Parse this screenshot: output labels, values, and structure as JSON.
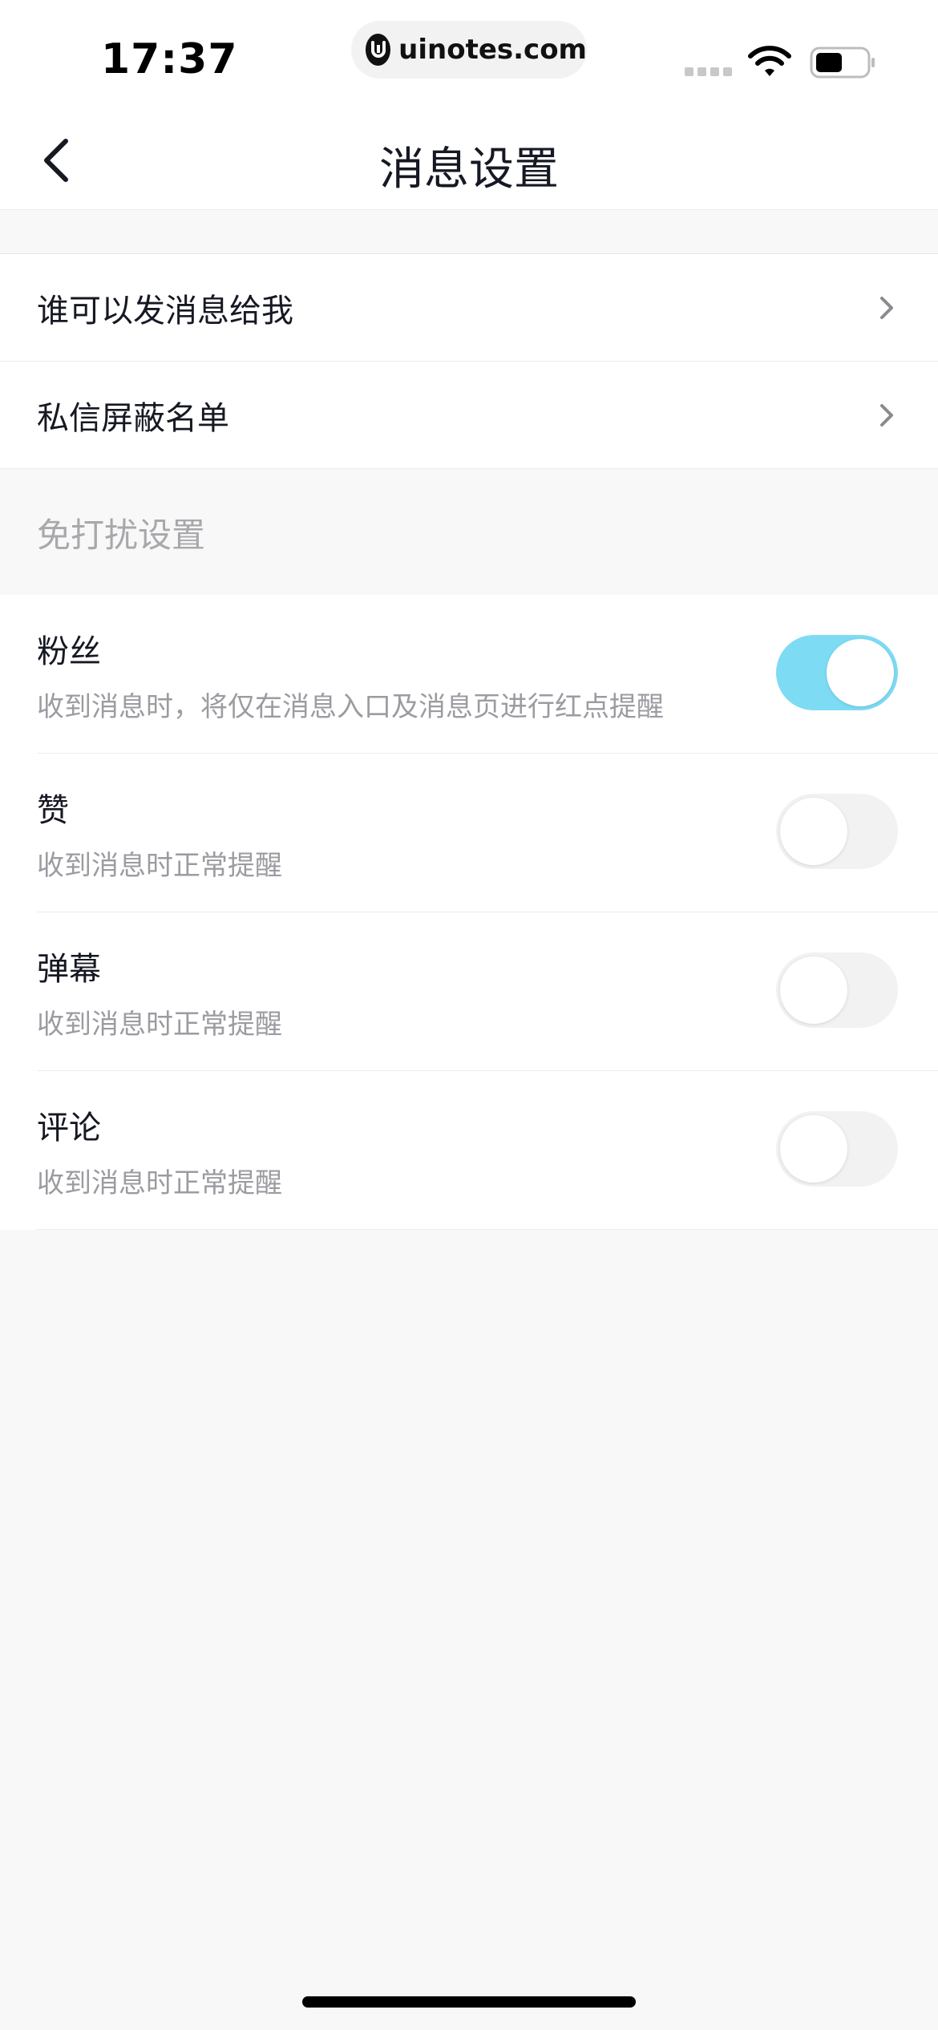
{
  "status_bar": {
    "time": "17:37",
    "url": "uinotes.com",
    "url_logo_letter": "U",
    "wifi_icon": "wifi-icon",
    "battery_icon": "battery-icon"
  },
  "header": {
    "back_icon": "chevron-left-icon",
    "title": "消息设置"
  },
  "nav_items": [
    {
      "label": "谁可以发消息给我",
      "icon": "chevron-right-icon"
    },
    {
      "label": "私信屏蔽名单",
      "icon": "chevron-right-icon"
    }
  ],
  "dnd_section": {
    "title": "免打扰设置",
    "items": [
      {
        "title": "粉丝",
        "subtitle": "收到消息时，将仅在消息入口及消息页进行红点提醒",
        "enabled": true
      },
      {
        "title": "赞",
        "subtitle": "收到消息时正常提醒",
        "enabled": false
      },
      {
        "title": "弹幕",
        "subtitle": "收到消息时正常提醒",
        "enabled": false
      },
      {
        "title": "评论",
        "subtitle": "收到消息时正常提醒",
        "enabled": false
      }
    ]
  },
  "colors": {
    "toggle_on": "#7ddcf4",
    "toggle_off": "#f2f2f2",
    "background": "#f8f8f8"
  }
}
